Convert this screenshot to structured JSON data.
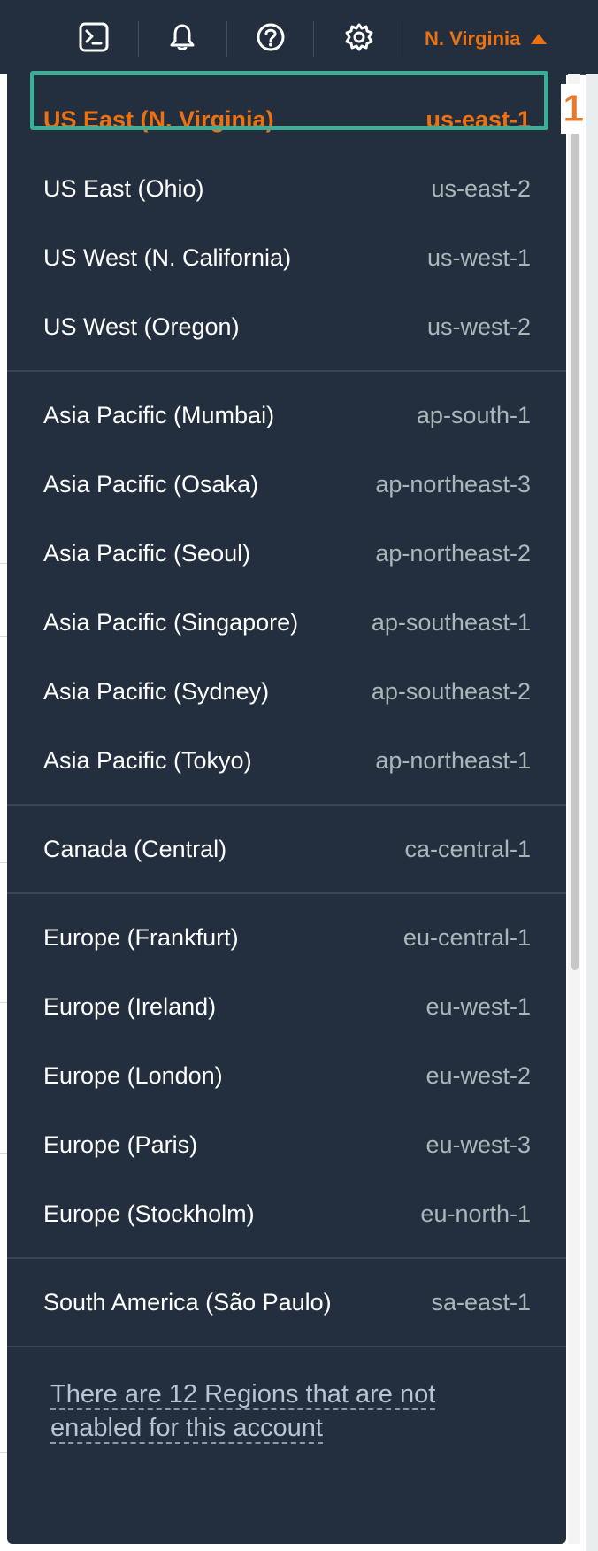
{
  "topbar": {
    "icons": [
      "cloudshell-icon",
      "bell-icon",
      "help-icon",
      "gear-icon"
    ],
    "region_label": "N. Virginia"
  },
  "regions": {
    "groups": [
      [
        {
          "name": "US East (N. Virginia)",
          "code": "us-east-1",
          "selected": true
        },
        {
          "name": "US East (Ohio)",
          "code": "us-east-2"
        },
        {
          "name": "US West (N. California)",
          "code": "us-west-1"
        },
        {
          "name": "US West (Oregon)",
          "code": "us-west-2"
        }
      ],
      [
        {
          "name": "Asia Pacific (Mumbai)",
          "code": "ap-south-1"
        },
        {
          "name": "Asia Pacific (Osaka)",
          "code": "ap-northeast-3"
        },
        {
          "name": "Asia Pacific (Seoul)",
          "code": "ap-northeast-2"
        },
        {
          "name": "Asia Pacific (Singapore)",
          "code": "ap-southeast-1"
        },
        {
          "name": "Asia Pacific (Sydney)",
          "code": "ap-southeast-2"
        },
        {
          "name": "Asia Pacific (Tokyo)",
          "code": "ap-northeast-1"
        }
      ],
      [
        {
          "name": "Canada (Central)",
          "code": "ca-central-1"
        }
      ],
      [
        {
          "name": "Europe (Frankfurt)",
          "code": "eu-central-1"
        },
        {
          "name": "Europe (Ireland)",
          "code": "eu-west-1"
        },
        {
          "name": "Europe (London)",
          "code": "eu-west-2"
        },
        {
          "name": "Europe (Paris)",
          "code": "eu-west-3"
        },
        {
          "name": "Europe (Stockholm)",
          "code": "eu-north-1"
        }
      ],
      [
        {
          "name": "South America (São Paulo)",
          "code": "sa-east-1"
        }
      ]
    ],
    "footer_link": "There are 12 Regions that are not enabled for this account"
  },
  "annotation": {
    "step_number": "1"
  },
  "colors": {
    "nav_bg": "#232f3e",
    "accent": "#ec7211",
    "highlight_border": "#3fae98"
  }
}
